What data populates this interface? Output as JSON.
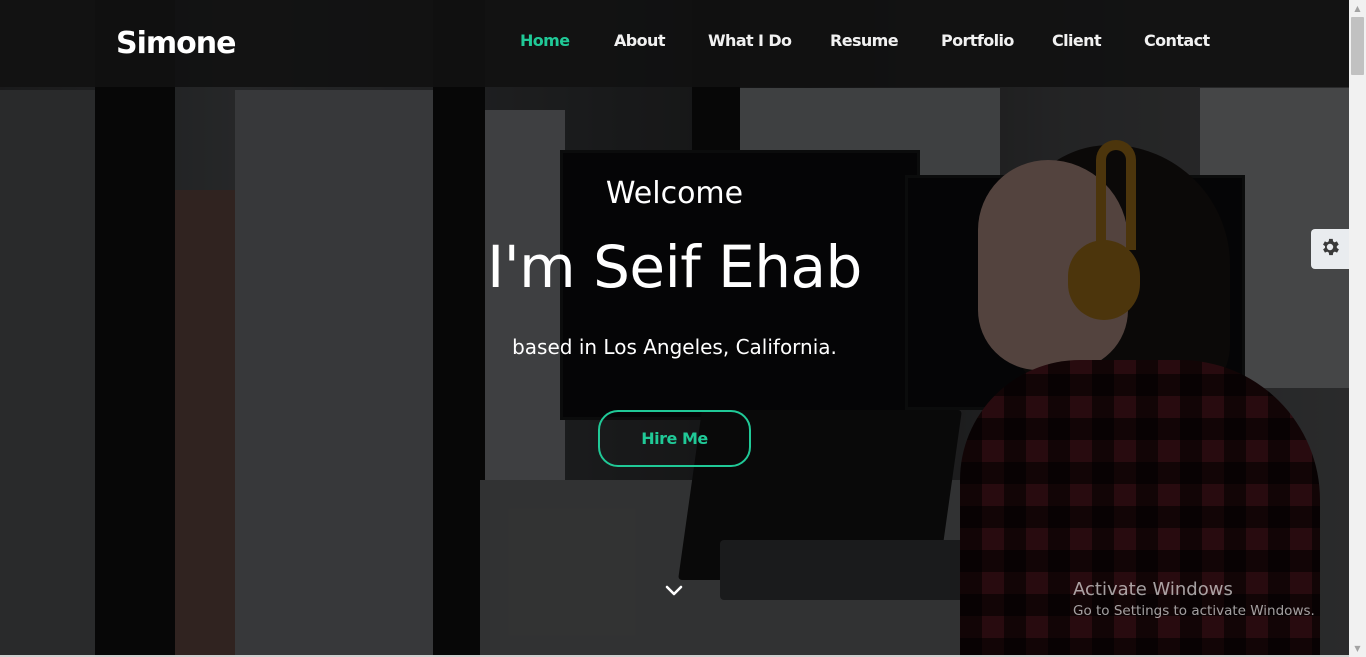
{
  "header": {
    "brand": "Simone",
    "nav": [
      {
        "label": "Home",
        "active": true
      },
      {
        "label": "About",
        "active": false
      },
      {
        "label": "What I Do",
        "active": false
      },
      {
        "label": "Resume",
        "active": false
      },
      {
        "label": "Portfolio",
        "active": false
      },
      {
        "label": "Client",
        "active": false
      },
      {
        "label": "Contact",
        "active": false
      }
    ]
  },
  "hero": {
    "welcome": "Welcome",
    "headline": "I'm Seif Ehab",
    "location": "based in Los Angeles, California.",
    "cta_label": "Hire Me",
    "scroll_icon": "chevron-down-icon"
  },
  "settings": {
    "icon": "gear-icon"
  },
  "watermark": {
    "title": "Activate Windows",
    "subtitle": "Go to Settings to activate Windows."
  },
  "colors": {
    "accent": "#20c997",
    "header_bg": "#111111",
    "text": "#ffffff"
  }
}
